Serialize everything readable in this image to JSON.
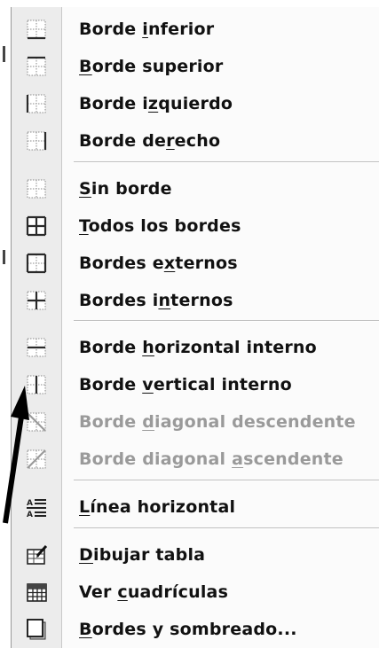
{
  "menu": {
    "items": [
      {
        "id": "inferior",
        "pre": "Borde ",
        "key": "i",
        "post": "nferior",
        "icon": "border-bottom-icon",
        "disabled": false
      },
      {
        "id": "superior",
        "pre": "",
        "key": "B",
        "post": "orde superior",
        "icon": "border-top-icon",
        "disabled": false
      },
      {
        "id": "izquierdo",
        "pre": "Borde i",
        "key": "z",
        "post": "quierdo",
        "icon": "border-left-icon",
        "disabled": false
      },
      {
        "id": "derecho",
        "pre": "Borde de",
        "key": "r",
        "post": "echo",
        "icon": "border-right-icon",
        "disabled": false
      },
      {
        "id": "sin",
        "pre": "",
        "key": "S",
        "post": "in borde",
        "icon": "no-border-icon",
        "disabled": false
      },
      {
        "id": "todos",
        "pre": "",
        "key": "T",
        "post": "odos los bordes",
        "icon": "all-borders-icon",
        "disabled": false
      },
      {
        "id": "externos",
        "pre": "Bordes e",
        "key": "x",
        "post": "ternos",
        "icon": "outside-borders-icon",
        "disabled": false
      },
      {
        "id": "internos",
        "pre": "Bordes i",
        "key": "n",
        "post": "ternos",
        "icon": "inside-borders-icon",
        "disabled": false
      },
      {
        "id": "horizontal",
        "pre": "Borde ",
        "key": "h",
        "post": "orizontal interno",
        "icon": "inside-horizontal-border-icon",
        "disabled": false
      },
      {
        "id": "vertical",
        "pre": "Borde ",
        "key": "v",
        "post": "ertical interno",
        "icon": "inside-vertical-border-icon",
        "disabled": false
      },
      {
        "id": "desc",
        "pre": "Borde ",
        "key": "d",
        "post": "iagonal descendente",
        "icon": "diagonal-down-border-icon",
        "disabled": true
      },
      {
        "id": "asc",
        "pre": "Borde diagonal ",
        "key": "a",
        "post": "scendente",
        "icon": "diagonal-up-border-icon",
        "disabled": true
      },
      {
        "id": "linea",
        "pre": "",
        "key": "L",
        "post": "ínea horizontal",
        "icon": "horizontal-line-icon",
        "disabled": false
      },
      {
        "id": "dibujar",
        "pre": "",
        "key": "D",
        "post": "ibujar tabla",
        "icon": "draw-table-icon",
        "disabled": false
      },
      {
        "id": "cuadriculas",
        "pre": "Ver ",
        "key": "c",
        "post": "uadrículas",
        "icon": "view-gridlines-icon",
        "disabled": false
      },
      {
        "id": "sombreado",
        "pre": "",
        "key": "B",
        "post": "ordes y sombreado...",
        "icon": "borders-shading-icon",
        "disabled": false
      }
    ]
  },
  "colors": {
    "text": "#111111",
    "disabled_text": "#9a9a9a",
    "gutter": "#ececec",
    "menu_bg": "#fbfbfb"
  }
}
